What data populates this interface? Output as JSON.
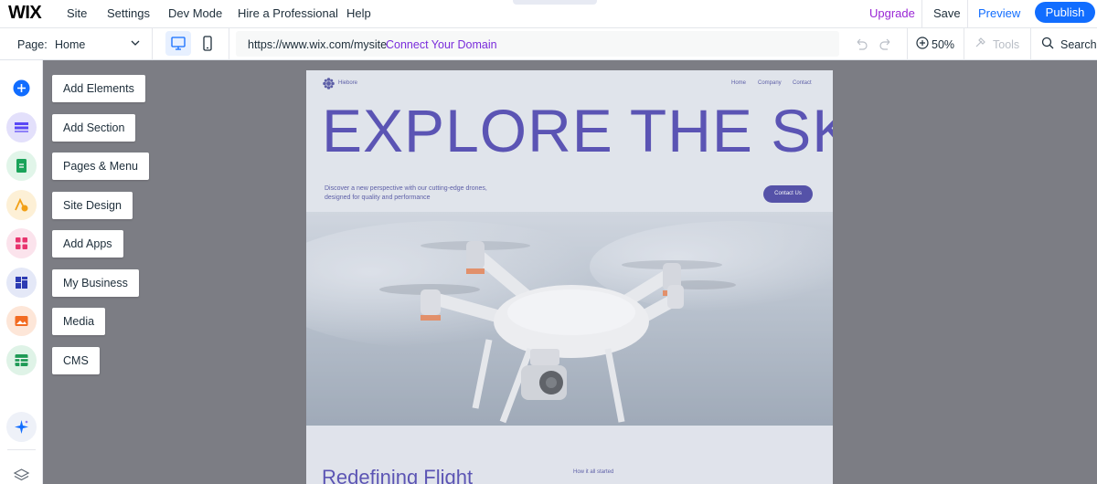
{
  "topbar": {
    "logo": "WIX",
    "menu": [
      "Site",
      "Settings",
      "Dev Mode",
      "Hire a Professional",
      "Help"
    ],
    "upgrade": "Upgrade",
    "save": "Save",
    "preview": "Preview",
    "publish": "Publish"
  },
  "toolbar": {
    "page_label": "Page:",
    "page_value": "Home",
    "url": "https://www.wix.com/mysite",
    "connect_domain": "Connect Your Domain",
    "zoom": "50%",
    "tools": "Tools",
    "search": "Search"
  },
  "sidebar": {
    "items": [
      {
        "label": "Add Elements",
        "icon": "plus-icon",
        "color": "#116dff",
        "bg": "#eaf1ff"
      },
      {
        "label": "Add Section",
        "icon": "section-icon",
        "color": "#5a48f5",
        "bg": "#e3e0fb"
      },
      {
        "label": "Pages & Menu",
        "icon": "page-icon",
        "color": "#1aa35a",
        "bg": "#e1f5e9"
      },
      {
        "label": "Site Design",
        "icon": "design-icon",
        "color": "#f2a017",
        "bg": "#fdf0d6"
      },
      {
        "label": "Add Apps",
        "icon": "apps-icon",
        "color": "#e8346e",
        "bg": "#fbe3ec"
      },
      {
        "label": "My Business",
        "icon": "business-icon",
        "color": "#2c3bb3",
        "bg": "#e4e8f7"
      },
      {
        "label": "Media",
        "icon": "media-icon",
        "color": "#f26b21",
        "bg": "#fde6d8"
      },
      {
        "label": "CMS",
        "icon": "cms-icon",
        "color": "#1f9a56",
        "bg": "#dff3e7"
      }
    ],
    "ai_icon": "sparkle-icon",
    "layers_icon": "layers-icon"
  },
  "site": {
    "brand": "Hiebore",
    "nav": [
      "Home",
      "Company",
      "Contact"
    ],
    "hero_title": "EXPLORE THE SKY",
    "hero_subtitle": "Discover a new perspective with our cutting-edge drones, designed for quality and performance",
    "contact_button": "Contact Us",
    "section_title": "Redefining Flight",
    "section_kicker": "How it all started"
  }
}
